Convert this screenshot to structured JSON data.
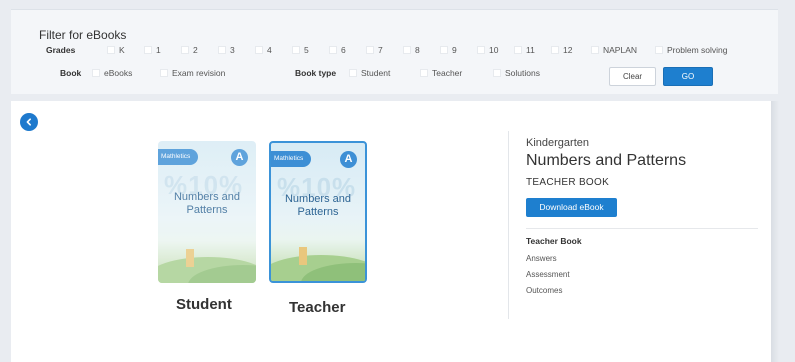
{
  "filter": {
    "title": "Filter for eBooks",
    "grades_label": "Grades",
    "grades": [
      "K",
      "1",
      "2",
      "3",
      "4",
      "5",
      "6",
      "7",
      "8",
      "9",
      "10",
      "11",
      "12",
      "NAPLAN",
      "Problem solving"
    ],
    "book_label": "Book",
    "book_options": [
      "eBooks",
      "Exam revision"
    ],
    "book_type_label": "Book type",
    "book_type_options": [
      "Student",
      "Teacher",
      "Solutions"
    ],
    "clear_label": "Clear",
    "go_label": "GO"
  },
  "covers": {
    "brand": "Mathletics",
    "level": "A",
    "title_line1": "Numbers and",
    "title_line2": "Patterns",
    "watermark": "%10%"
  },
  "books": [
    {
      "label": "Student"
    },
    {
      "label": "Teacher"
    }
  ],
  "detail": {
    "grade": "Kindergarten",
    "title": "Numbers and Patterns",
    "type": "TEACHER BOOK",
    "download_label": "Download eBook",
    "section_title": "Teacher Book",
    "links": [
      "Answers",
      "Assessment",
      "Outcomes"
    ]
  },
  "colors": {
    "accent": "#1e7fcf",
    "selected_border": "#3b93d8"
  },
  "icons": {
    "back": "chevron-left-icon"
  }
}
